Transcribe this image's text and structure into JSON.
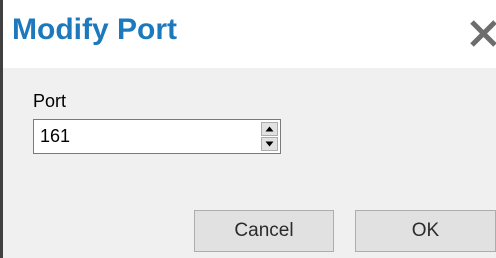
{
  "dialog": {
    "title": "Modify Port",
    "close_icon": "close-icon"
  },
  "form": {
    "port_label": "Port",
    "port_value": "161",
    "spin_up_icon": "triangle-up-icon",
    "spin_down_icon": "triangle-down-icon"
  },
  "buttons": {
    "cancel_label": "Cancel",
    "ok_label": "OK"
  },
  "colors": {
    "title": "#1c79be",
    "content_background": "#f0f0f0",
    "button_background": "#e1e1e1",
    "window_border": "#404040"
  }
}
